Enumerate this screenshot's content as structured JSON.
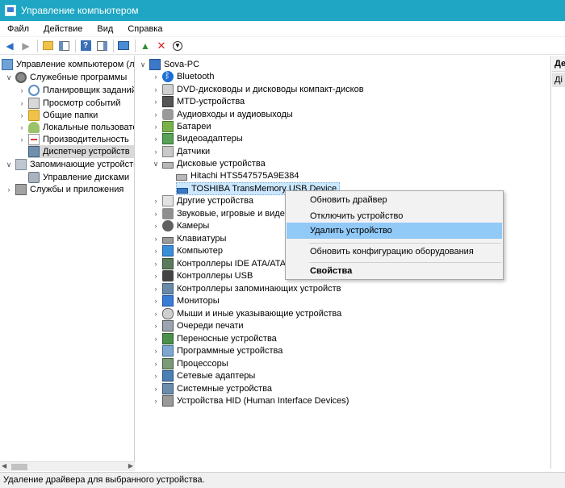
{
  "window": {
    "title": "Управление компьютером"
  },
  "menu": [
    "Файл",
    "Действие",
    "Вид",
    "Справка"
  ],
  "colors": {
    "titlebar": "#1ea6c4",
    "menu_highlight": "#91c9f7",
    "selection": "#cce8ff"
  },
  "left_tree": [
    {
      "label": "Управление компьютером (л",
      "icon": "computer-management-icon"
    },
    {
      "label": "Служебные программы",
      "icon": "tools-icon"
    },
    {
      "label": "Планировщик заданий",
      "icon": "task-scheduler-icon"
    },
    {
      "label": "Просмотр событий",
      "icon": "event-viewer-icon"
    },
    {
      "label": "Общие папки",
      "icon": "shared-folders-icon"
    },
    {
      "label": "Локальные пользовате",
      "icon": "local-users-icon"
    },
    {
      "label": "Производительность",
      "icon": "performance-icon"
    },
    {
      "label": "Диспетчер устройств",
      "icon": "device-manager-icon"
    },
    {
      "label": "Запоминающие устройства",
      "icon": "storage-icon"
    },
    {
      "label": "Управление дисками",
      "icon": "disk-management-icon"
    },
    {
      "label": "Службы и приложения",
      "icon": "services-icon"
    }
  ],
  "device_tree": [
    {
      "label": "Sova-PC",
      "icon": "pc-icon"
    },
    {
      "label": "Bluetooth",
      "icon": "bluetooth-icon"
    },
    {
      "label": "DVD-дисководы и дисководы компакт-дисков",
      "icon": "dvd-drive-icon"
    },
    {
      "label": "MTD-устройства",
      "icon": "mtd-device-icon"
    },
    {
      "label": "Аудиовходы и аудиовыходы",
      "icon": "audio-io-icon"
    },
    {
      "label": "Батареи",
      "icon": "battery-icon"
    },
    {
      "label": "Видеоадаптеры",
      "icon": "video-adapter-icon"
    },
    {
      "label": "Датчики",
      "icon": "sensor-icon"
    },
    {
      "label": "Дисковые устройства",
      "icon": "disk-drive-icon"
    },
    {
      "label": "Hitachi HTS547575A9E384",
      "icon": "hard-drive-icon"
    },
    {
      "label": "TOSHIBA TransMemory USB Device",
      "icon": "usb-flash-drive-icon"
    },
    {
      "label": "Другие устройства",
      "icon": "other-devices-icon"
    },
    {
      "label": "Звуковые, игровые и видео",
      "icon": "sound-icon"
    },
    {
      "label": "Камеры",
      "icon": "camera-icon"
    },
    {
      "label": "Клавиатуры",
      "icon": "keyboard-icon"
    },
    {
      "label": "Компьютер",
      "icon": "computer-icon"
    },
    {
      "label": "Контроллеры IDE ATA/ATAP",
      "icon": "ide-controller-icon"
    },
    {
      "label": "Контроллеры USB",
      "icon": "usb-controller-icon"
    },
    {
      "label": "Контроллеры запоминающих устройств",
      "icon": "storage-controller-icon"
    },
    {
      "label": "Мониторы",
      "icon": "monitor-icon"
    },
    {
      "label": "Мыши и иные указывающие устройства",
      "icon": "mouse-icon"
    },
    {
      "label": "Очереди печати",
      "icon": "print-queue-icon"
    },
    {
      "label": "Переносные устройства",
      "icon": "portable-device-icon"
    },
    {
      "label": "Программные устройства",
      "icon": "software-device-icon"
    },
    {
      "label": "Процессоры",
      "icon": "processor-icon"
    },
    {
      "label": "Сетевые адаптеры",
      "icon": "network-adapter-icon"
    },
    {
      "label": "Системные устройства",
      "icon": "system-device-icon"
    },
    {
      "label": "Устройства HID (Human Interface Devices)",
      "icon": "hid-icon"
    }
  ],
  "context_menu": [
    "Обновить драйвер",
    "Отключить устройство",
    "Удалить устройство",
    "Обновить конфигурацию оборудования",
    "Свойства"
  ],
  "right_pane": {
    "header": "Де",
    "item": "Ді"
  },
  "status": "Удаление драйвера для выбранного устройства."
}
